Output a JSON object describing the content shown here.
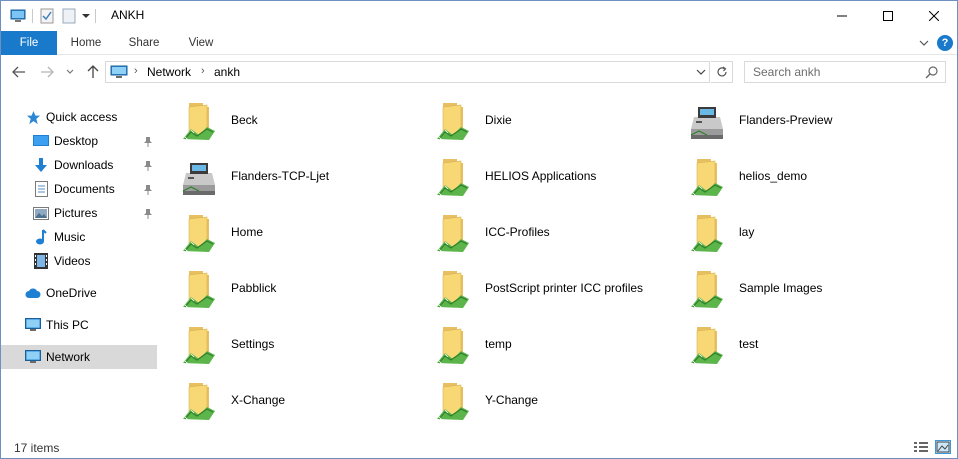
{
  "window": {
    "title": "ANKH",
    "minimize_icon": "minimize-icon",
    "maximize_icon": "maximize-icon",
    "close_icon": "close-icon"
  },
  "quick_access_toolbar": {
    "icons": [
      "computer-icon",
      "properties-icon",
      "new-folder-icon",
      "dropdown-arrow-icon"
    ]
  },
  "ribbon": {
    "tabs": [
      {
        "label": "File",
        "active": true
      },
      {
        "label": "Home"
      },
      {
        "label": "Share"
      },
      {
        "label": "View"
      }
    ],
    "accent": "#1979ca",
    "help_label": "?"
  },
  "navigation": {
    "breadcrumb": [
      "Network",
      "ankh"
    ],
    "search_placeholder": "Search ankh"
  },
  "sidebar": {
    "sections": [
      {
        "label": "Quick access",
        "icon": "star-icon"
      },
      {
        "label": "Desktop",
        "icon": "desktop-icon",
        "pinned": true
      },
      {
        "label": "Downloads",
        "icon": "download-icon",
        "pinned": true
      },
      {
        "label": "Documents",
        "icon": "documents-icon",
        "pinned": true
      },
      {
        "label": "Pictures",
        "icon": "pictures-icon",
        "pinned": true
      },
      {
        "label": "Music",
        "icon": "music-icon"
      },
      {
        "label": "Videos",
        "icon": "videos-icon"
      },
      {
        "label": "OneDrive",
        "icon": "cloud-icon"
      },
      {
        "label": "This PC",
        "icon": "computer-icon"
      },
      {
        "label": "Network",
        "icon": "network-icon",
        "selected": true
      }
    ]
  },
  "items": [
    {
      "name": "Beck",
      "type": "share"
    },
    {
      "name": "Dixie",
      "type": "share"
    },
    {
      "name": "Flanders-Preview",
      "type": "printer"
    },
    {
      "name": "Flanders-TCP-Ljet",
      "type": "printer"
    },
    {
      "name": "HELIOS Applications",
      "type": "share"
    },
    {
      "name": "helios_demo",
      "type": "share"
    },
    {
      "name": "Home",
      "type": "share"
    },
    {
      "name": "ICC-Profiles",
      "type": "share"
    },
    {
      "name": "lay",
      "type": "share"
    },
    {
      "name": "Pabblick",
      "type": "share"
    },
    {
      "name": "PostScript printer ICC profiles",
      "type": "share"
    },
    {
      "name": "Sample Images",
      "type": "share"
    },
    {
      "name": "Settings",
      "type": "share"
    },
    {
      "name": "temp",
      "type": "share"
    },
    {
      "name": "test",
      "type": "share"
    },
    {
      "name": "X-Change",
      "type": "share"
    },
    {
      "name": "Y-Change",
      "type": "share"
    }
  ],
  "status": {
    "item_count": "17 items"
  }
}
